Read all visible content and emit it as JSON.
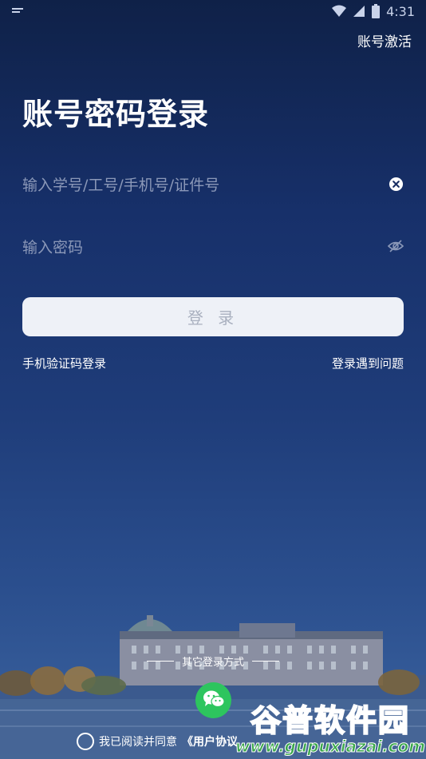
{
  "status_bar": {
    "time": "4:31",
    "left_icon": "notification-icon",
    "icons": [
      "wifi-icon",
      "signal-icon",
      "battery-icon"
    ]
  },
  "header": {
    "activate_label": "账号激活"
  },
  "main": {
    "title": "账号密码登录",
    "account_placeholder": "输入学号/工号/手机号/证件号",
    "password_placeholder": "输入密码",
    "login_label": "登 录",
    "sms_login_label": "手机验证码登录",
    "trouble_label": "登录遇到问题"
  },
  "other_login": {
    "label": "其它登录方式",
    "wechat_icon": "wechat-icon"
  },
  "agreement": {
    "prefix": "我已阅读并同意",
    "user_agreement": "《用户协议"
  },
  "watermark": {
    "title": "谷普软件园",
    "url": "www.gupuxiazai.com"
  },
  "colors": {
    "background_top": "#0f2148",
    "background_bottom": "#3c64a0",
    "button_bg": "#eef1f7",
    "wechat_green": "#2dc55e",
    "watermark_green": "#3aa84a"
  }
}
